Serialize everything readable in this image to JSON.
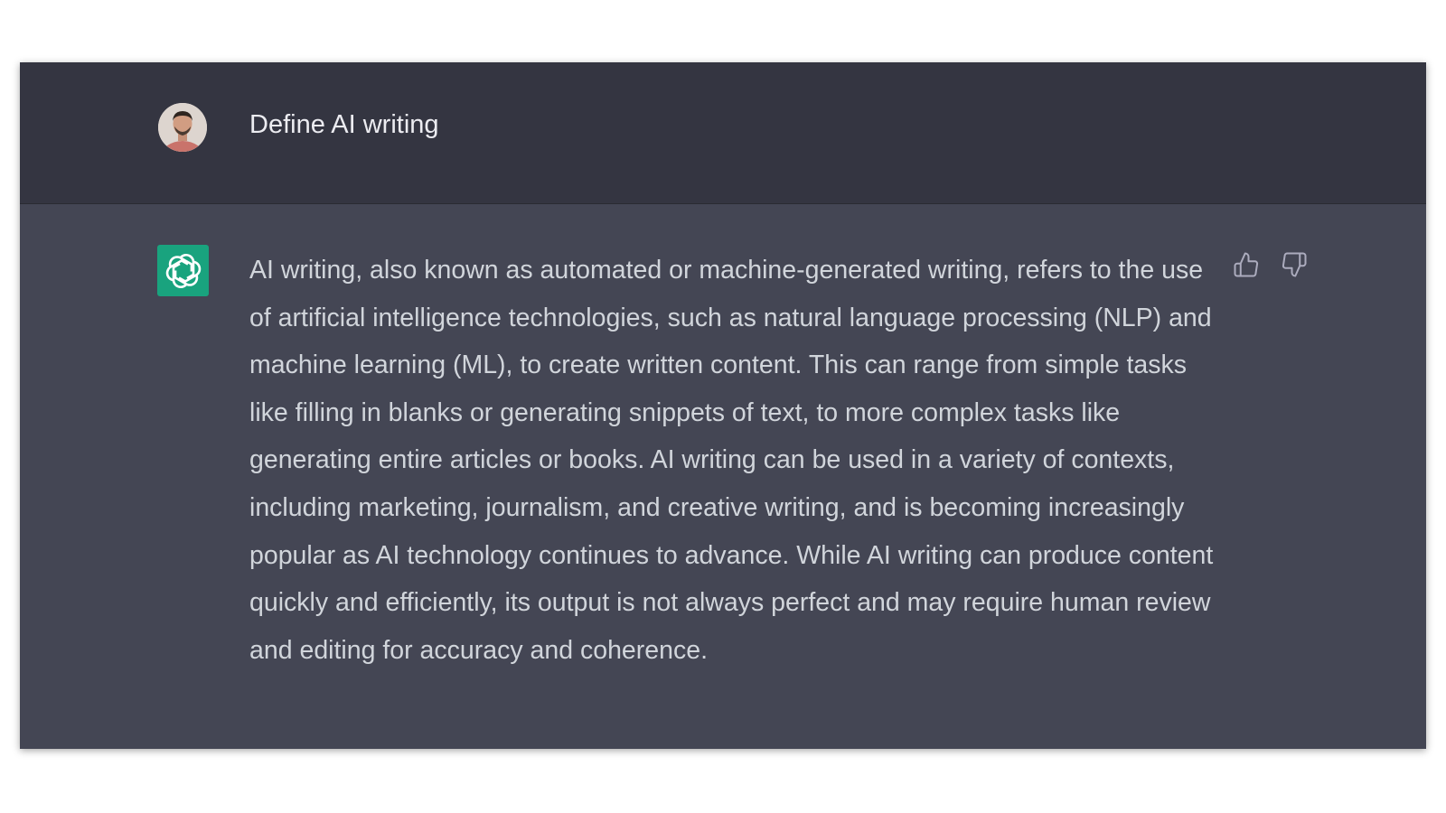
{
  "conversation": {
    "user_message": {
      "text": "Define AI writing",
      "avatar_icon": "user-avatar-photo"
    },
    "assistant_message": {
      "text": "AI writing, also known as automated or machine-generated writing, refers to the use of artificial intelligence technologies, such as natural language processing (NLP) and machine learning (ML), to create written content. This can range from simple tasks like filling in blanks or generating snippets of text, to more complex tasks like generating entire articles or books. AI writing can be used in a variety of contexts, including marketing, journalism, and creative writing, and is becoming increasingly popular as AI technology continues to advance. While AI writing can produce content quickly and efficiently, its output is not always perfect and may require human review and editing for accuracy and coherence.",
      "logo_icon": "openai-logo-icon",
      "feedback": {
        "thumbs_up_icon": "thumbs-up-icon",
        "thumbs_down_icon": "thumbs-down-icon"
      }
    }
  },
  "colors": {
    "user_row_bg": "#343541",
    "assistant_row_bg": "#444654",
    "logo_bg": "#19a37e",
    "user_text": "#ececf1",
    "assistant_text": "#d1d5db",
    "icon": "#acacbe"
  }
}
